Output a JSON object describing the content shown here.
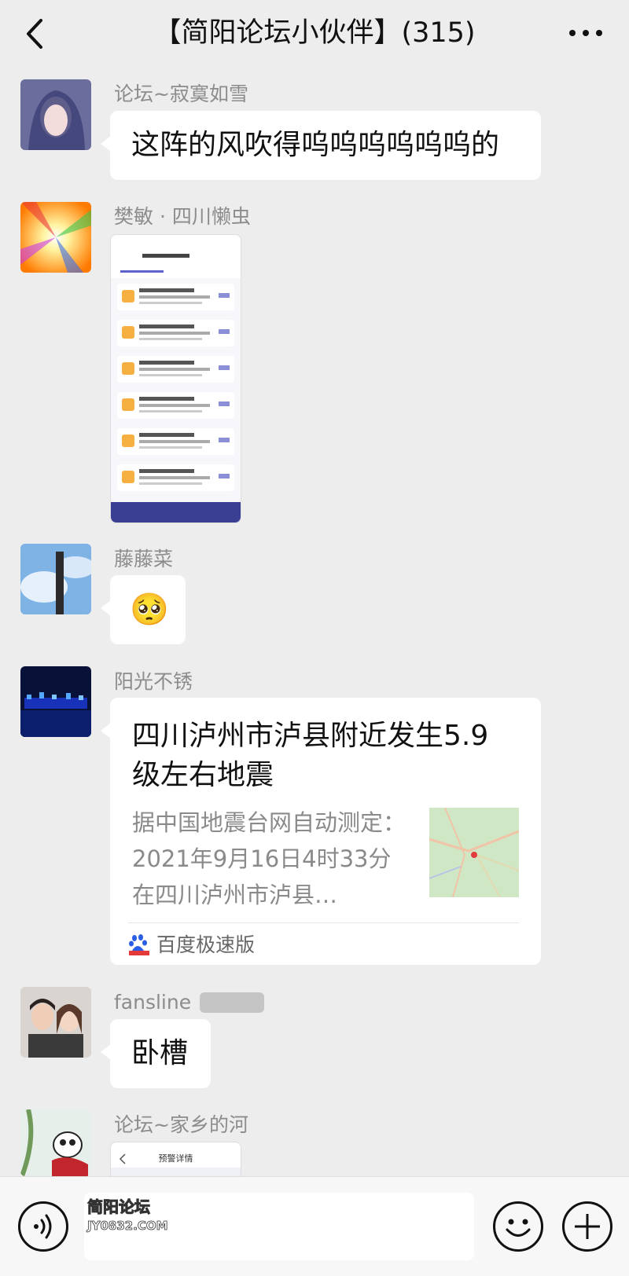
{
  "header": {
    "title": "【简阳论坛小伙伴】(315)"
  },
  "messages": [
    {
      "sender": "论坛~寂寞如雪",
      "text": "这阵的风吹得呜呜呜呜呜呜的"
    },
    {
      "sender": "樊敏 · 四川懒虫"
    },
    {
      "sender": "藤藤菜",
      "emoji": "🥺"
    },
    {
      "sender": "阳光不锈",
      "card": {
        "title": "四川泸州市泸县附近发生5.9级左右地震",
        "desc": "据中国地震台网自动测定：2021年9月16日4时33分在四川泸州市泸县…",
        "source": "百度极速版"
      }
    },
    {
      "sender": "fansline",
      "text": "卧槽"
    },
    {
      "sender": "论坛~家乡的河",
      "shot_title": "预警详情"
    }
  ],
  "input": {
    "watermark_line1": "简阳论坛",
    "watermark_line2": "JY0832.COM"
  },
  "colors": {
    "background": "#ededed",
    "bubble": "#ffffff",
    "name": "#8c8c8c"
  }
}
